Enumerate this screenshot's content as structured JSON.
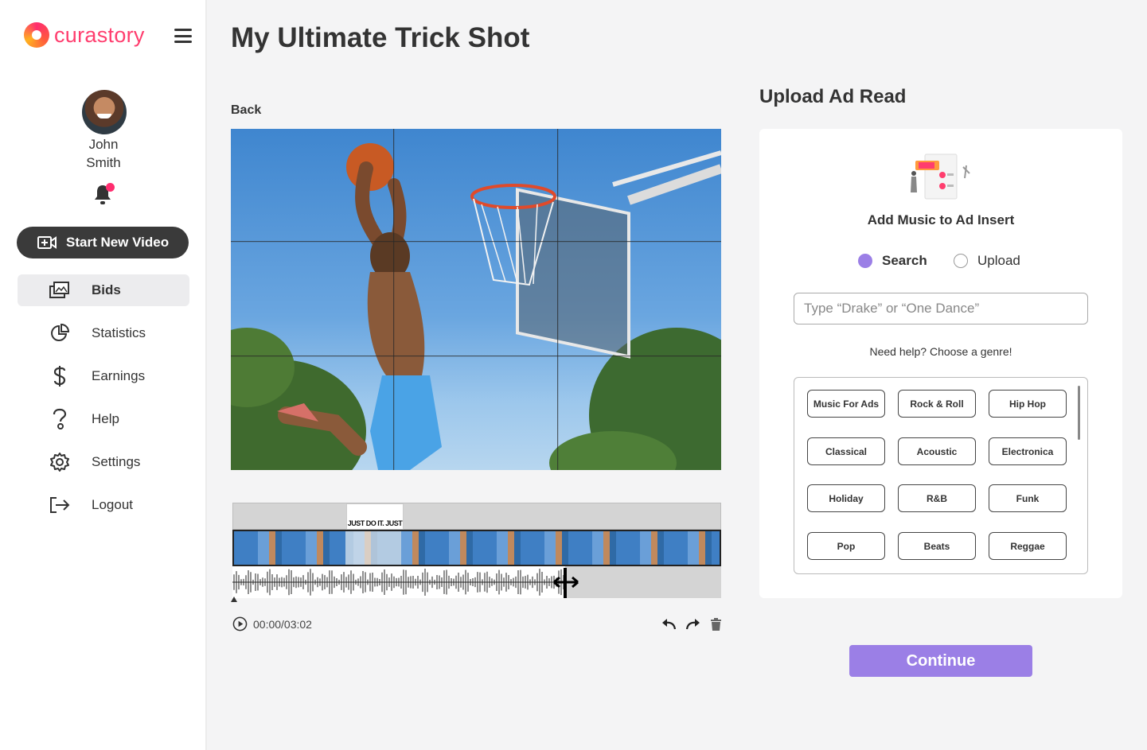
{
  "brand": {
    "name": "curastory",
    "color": "#ff3d6e"
  },
  "user": {
    "first_name": "John",
    "last_name": "Smith",
    "has_notifications": true
  },
  "sidebar": {
    "start_button": {
      "label": "Start New Video",
      "icon": "video-plus-icon"
    },
    "items": [
      {
        "label": "Bids",
        "icon": "bids-icon",
        "active": true
      },
      {
        "label": "Statistics",
        "icon": "pie-chart-icon",
        "active": false
      },
      {
        "label": "Earnings",
        "icon": "dollar-icon",
        "active": false
      },
      {
        "label": "Help",
        "icon": "help-icon",
        "active": false
      },
      {
        "label": "Settings",
        "icon": "gear-icon",
        "active": false
      },
      {
        "label": "Logout",
        "icon": "logout-icon",
        "active": false
      }
    ]
  },
  "main": {
    "title": "My Ultimate Trick Shot",
    "back_label": "Back",
    "timeline": {
      "ad_clip_label": "JUST DO IT. JUST",
      "current_time": "00:00/03:02"
    }
  },
  "panel": {
    "title": "Upload Ad Read",
    "heading": "Add Music to Ad Insert",
    "modes": [
      {
        "label": "Search",
        "selected": true
      },
      {
        "label": "Upload",
        "selected": false
      }
    ],
    "search_placeholder": "Type “Drake” or “One Dance”",
    "help_text": "Need help? Choose a genre!",
    "genres": [
      "Music For Ads",
      "Rock & Roll",
      "Hip Hop",
      "Classical",
      "Acoustic",
      "Electronica",
      "Holiday",
      "R&B",
      "Funk",
      "Pop",
      "Beats",
      "Reggae"
    ],
    "continue_label": "Continue",
    "accent_color": "#9b7fe6"
  }
}
